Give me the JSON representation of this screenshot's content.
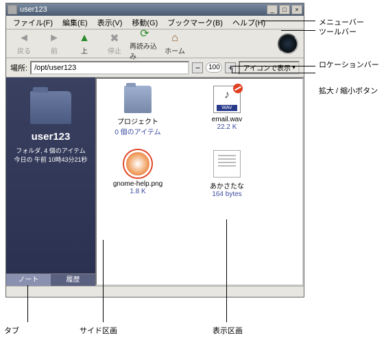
{
  "title": "user123",
  "menu": [
    "ファイル(F)",
    "編集(E)",
    "表示(V)",
    "移動(G)",
    "ブックマーク(B)",
    "ヘルプ(H)"
  ],
  "toolbar": {
    "back": "戻る",
    "fwd": "前",
    "up": "上",
    "stop": "停止",
    "reload": "再読み込み",
    "home": "ホーム"
  },
  "loc": {
    "label": "場所:",
    "value": "/opt/user123"
  },
  "zoom": {
    "value": "100"
  },
  "view_mode": "アイコンで表示",
  "sidebar": {
    "title": "user123",
    "line1": "フォルダ, 4 個のアイテム",
    "line2": "今日の 午前 10時43分21秒",
    "tabs": [
      "ノート",
      "履歴"
    ]
  },
  "files": [
    {
      "name": "プロジェクト",
      "sub": "0 個のアイテム",
      "ico": "ico-folder"
    },
    {
      "name": "email.wav",
      "sub": "22.2 K",
      "ico": "ico-wav",
      "badge": true
    },
    {
      "name": "gnome-help.png",
      "sub": "1.8 K",
      "ico": "ico-png"
    },
    {
      "name": "あかさたな",
      "sub": "164 bytes",
      "ico": "ico-doc"
    }
  ],
  "callouts": {
    "menubar": "メニューバー",
    "toolbar": "ツールバー",
    "locbar": "ロケーションバー",
    "zoom": "拡大 / 縮小ボタン",
    "tab": "タブ",
    "side": "サイド区画",
    "view": "表示区画"
  }
}
